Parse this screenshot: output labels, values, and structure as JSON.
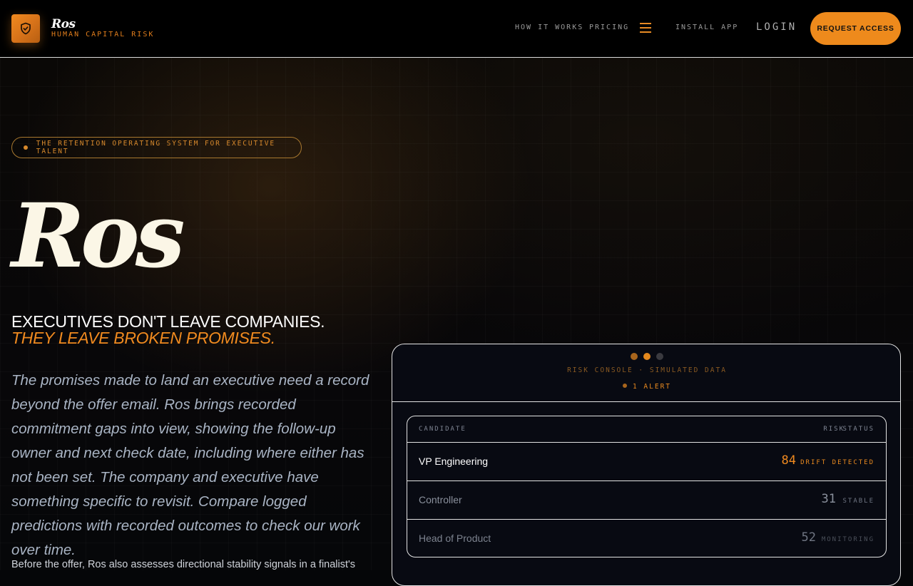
{
  "brand": {
    "name": "Ros",
    "subtitle": "HUMAN CAPITAL RISK"
  },
  "nav": {
    "links": [
      "HOW IT WORKS",
      "PRICING",
      "INSTALL APP"
    ],
    "login": "LOGIN",
    "cta": "REQUEST ACCESS",
    "menu_icon": "hamburger-icon"
  },
  "hero": {
    "pill": "THE RETENTION OPERATING SYSTEM FOR EXECUTIVE TALENT",
    "title": "Ros",
    "tagline_1": "EXECUTIVES DON'T LEAVE COMPANIES.",
    "tagline_2": "THEY LEAVE BROKEN PROMISES.",
    "description": "The promises made to land an executive need a record beyond the offer email. Ros brings recorded commitment gaps into view, showing the follow-up owner and next check date, including where either has not been set. The company and executive have something specific to revisit. Compare logged predictions with recorded outcomes to check our work over time.",
    "description_2": "Before the offer, Ros also assesses directional stability signals in a finalist's"
  },
  "console": {
    "title": "RISK CONSOLE · SIMULATED DATA",
    "alert": "1 ALERT",
    "columns": {
      "candidate": "CANDIDATE",
      "risk": "RISK",
      "status": "STATUS"
    },
    "rows": [
      {
        "name": "VP Engineering",
        "risk": "84",
        "status": "DRIFT DETECTED"
      },
      {
        "name": "Controller",
        "risk": "31",
        "status": "STABLE"
      },
      {
        "name": "Head of Product",
        "risk": "52",
        "status": "MONITORING"
      }
    ]
  },
  "colors": {
    "accent": "#ee8a1c",
    "background": "#050608",
    "text": "#e8e6df"
  }
}
